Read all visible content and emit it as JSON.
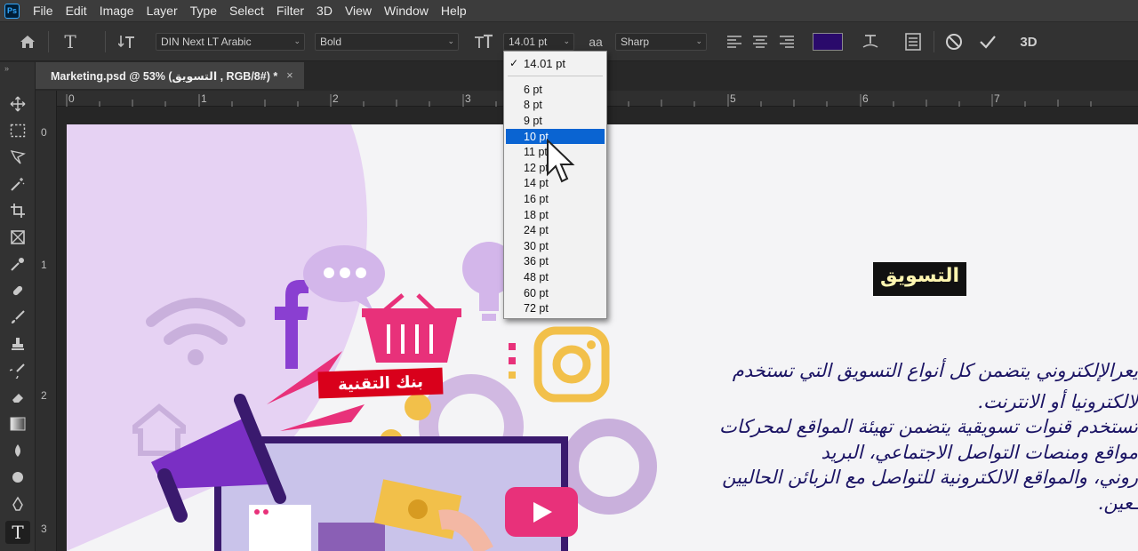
{
  "app": {
    "logo": "Ps"
  },
  "menu": [
    "File",
    "Edit",
    "Image",
    "Layer",
    "Type",
    "Select",
    "Filter",
    "3D",
    "View",
    "Window",
    "Help"
  ],
  "options": {
    "font_family": "DIN Next LT Arabic",
    "font_style": "Bold",
    "font_size": "14.01 pt",
    "aa_icon": "aa",
    "antialias": "Sharp",
    "color_swatch": "#2a0a6b",
    "three_d": "3D"
  },
  "document_tab": {
    "title": "Marketing.psd @ 53% (التسويق , RGB/8#) *",
    "close": "×"
  },
  "rulers": {
    "h_labels": [
      "0",
      "1",
      "2",
      "3",
      "4",
      "5",
      "6",
      "7"
    ],
    "v_labels": [
      "0",
      "1",
      "2",
      "3"
    ]
  },
  "canvas": {
    "title_text": "التسويق",
    "bank_label": "بنك التقنية",
    "paragraph_lines": [
      "يعرالإلكتروني يتضمن كل أنواع التسويق التي تستخدم",
      "لالكترونيا أو الانترنت.",
      "تستخدم قنوات تسويقية يتضمن تهيئة المواقع لمحركات",
      "مواقع ومنصات التواصل الاجتماعي، البريد",
      "روني، والمواقع الالكترونية للتواصل مع الزبائن الحاليين",
      "ـعين."
    ]
  },
  "size_menu": {
    "current": "14.01 pt",
    "check": "✓",
    "items": [
      "6 pt",
      "8 pt",
      "9 pt",
      "10 pt",
      "11 pt",
      "12 pt",
      "14 pt",
      "16 pt",
      "18 pt",
      "24 pt",
      "30 pt",
      "36 pt",
      "48 pt",
      "60 pt",
      "72 pt"
    ],
    "highlighted": "10 pt"
  },
  "colors": {
    "accent_highlight": "#0a64d2",
    "purple": "#7a2fc4",
    "pink": "#e8317a",
    "gold": "#f2c04a"
  }
}
